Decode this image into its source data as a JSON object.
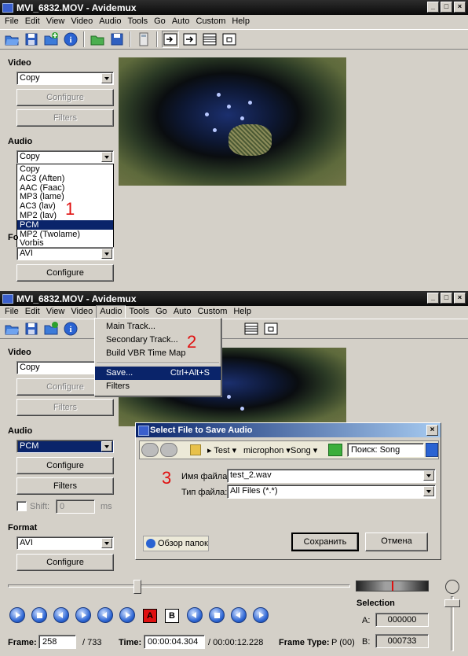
{
  "top_window": {
    "title": "MVI_6832.MOV - Avidemux",
    "menu": [
      "File",
      "Edit",
      "View",
      "Video",
      "Audio",
      "Tools",
      "Go",
      "Auto",
      "Custom",
      "Help"
    ],
    "video_label": "Video",
    "video_codec": "Copy",
    "configure_label": "Configure",
    "filters_label": "Filters",
    "audio_label": "Audio",
    "audio_codec": "Copy",
    "audio_options": [
      "Copy",
      "AC3 (Aften)",
      "AAC (Faac)",
      "MP3 (lame)",
      "AC3 (lav)",
      "MP2 (lav)",
      "PCM",
      "MP2 (Twolame)",
      "Vorbis"
    ],
    "audio_selected": "PCM",
    "format_label_partial": "Fo",
    "format_value": "AVI",
    "format_configure_label": "Configure",
    "step": "1"
  },
  "bottom_window": {
    "title": "MVI_6832.MOV - Avidemux",
    "menu": [
      "File",
      "Edit",
      "View",
      "Video",
      "Audio",
      "Tools",
      "Go",
      "Auto",
      "Custom",
      "Help"
    ],
    "video_label": "Video",
    "video_codec": "Copy",
    "configure_label": "Configure",
    "filters_label": "Filters",
    "audio_label": "Audio",
    "audio_codec": "PCM",
    "audio_configure_label": "Configure",
    "audio_filters_label": "Filters",
    "shift_label": "Shift:",
    "shift_value": "0",
    "shift_unit": "ms",
    "format_label": "Format",
    "format_value": "AVI",
    "format_configure_label": "Configure",
    "audio_menu": {
      "items": [
        {
          "label": "Main Track...",
          "shortcut": ""
        },
        {
          "label": "Secondary Track...",
          "shortcut": ""
        },
        {
          "label": "Build VBR Time Map",
          "shortcut": ""
        },
        {
          "label": "Save...",
          "shortcut": "Ctrl+Alt+S"
        },
        {
          "label": "Filters",
          "shortcut": ""
        }
      ],
      "highlighted": "Save..."
    },
    "step2": "2",
    "dialog": {
      "title": "Select File to Save Audio",
      "breadcrumb": [
        "Test",
        "microphon",
        "Song"
      ],
      "search_placeholder": "Поиск: Song",
      "filename_label": "Имя файла:",
      "filename_value": "test_2.wav",
      "filetype_label": "Тип файла:",
      "filetype_value": "All Files (*.*)",
      "browse_label": "Обзор папок",
      "save_label": "Сохранить",
      "cancel_label": "Отмена",
      "step3": "3"
    },
    "selection_label": "Selection",
    "a_label": "A:",
    "a_value": "000000",
    "b_label": "B:",
    "b_value": "000733",
    "frame_label": "Frame:",
    "frame_value": "258",
    "frame_total": "/ 733",
    "time_label": "Time:",
    "time_value": "00:00:04.304",
    "time_total": "/ 00:00:12.228",
    "frame_type_label": "Frame Type:",
    "frame_type_value": "P (00)",
    "marker_a": "A",
    "marker_b": "B"
  }
}
